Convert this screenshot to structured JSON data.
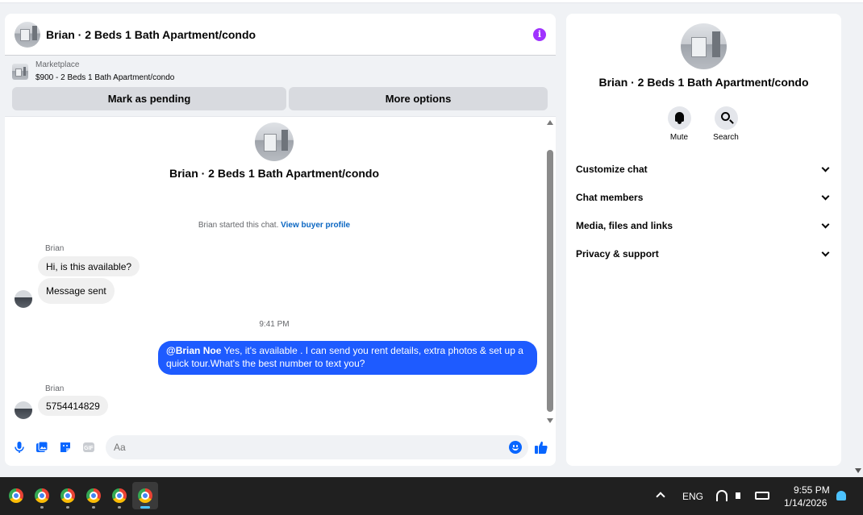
{
  "chat": {
    "header_title": "Brian · 2 Beds 1 Bath Apartment/condo",
    "info_icon": "i",
    "marketplace_label": "Marketplace",
    "listing": "$900 - 2 Beds 1 Bath Apartment/condo",
    "mark_pending": "Mark as pending",
    "more_options": "More options",
    "thread_title": "Brian · 2 Beds 1 Bath Apartment/condo",
    "started_text": "Brian started this chat.",
    "view_profile": "View buyer profile",
    "messages": [
      {
        "sender": "Brian",
        "text": "Hi, is this available?"
      },
      {
        "text": "Message sent"
      },
      {
        "timestamp": "9:41 PM"
      },
      {
        "mention": "@Brian Noe",
        "text": " Yes, it's available .  I can send you rent details, extra photos & set up a quick tour.What's the best number to text you?"
      },
      {
        "sender": "Brian",
        "text": "5754414829"
      }
    ],
    "composer_placeholder": "Aa"
  },
  "info_panel": {
    "title": "Brian · 2 Beds 1 Bath Apartment/condo",
    "mute_label": "Mute",
    "search_label": "Search",
    "sections": [
      "Customize chat",
      "Chat members",
      "Media, files and links",
      "Privacy & support"
    ]
  },
  "taskbar": {
    "language": "ENG",
    "time": "9:55 PM",
    "date": "1/14/2026"
  },
  "colors": {
    "accent_blue": "#1e5bff",
    "info_purple": "#a033ff",
    "link_blue": "#0a66c2",
    "icon_blue": "#0866ff"
  },
  "icons": [
    "info-icon",
    "mic-icon",
    "photo-icon",
    "sticker-icon",
    "gif-icon",
    "emoji-icon",
    "thumbs-up-icon",
    "bell-icon",
    "search-icon",
    "chevron-down-icon",
    "chrome-icon",
    "wifi-icon",
    "speaker-icon",
    "battery-icon",
    "notification-icon"
  ]
}
